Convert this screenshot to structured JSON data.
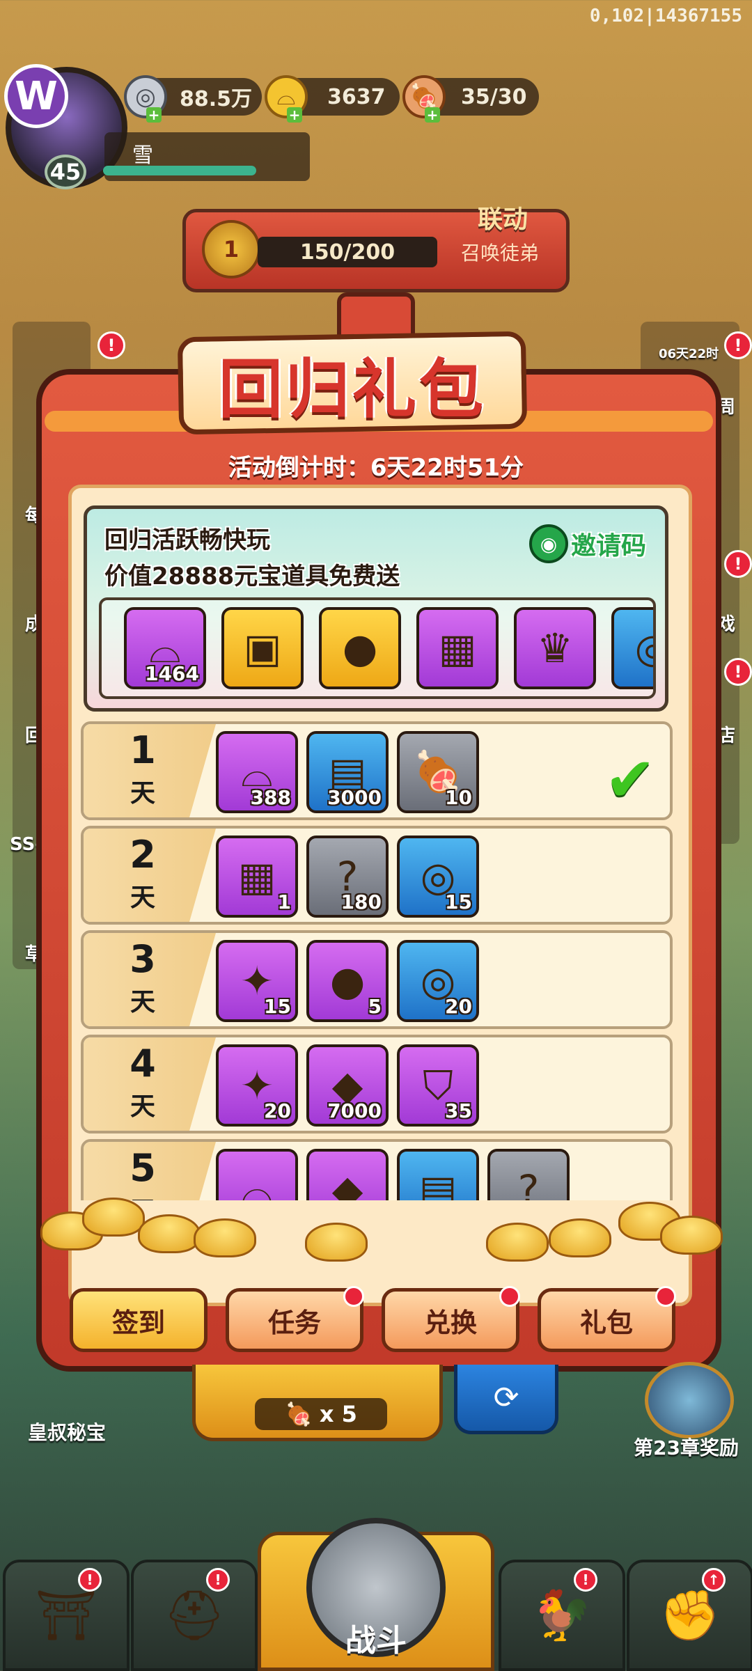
{
  "hud": {
    "server_id": "0,102|14367155",
    "avatar_logo": "W",
    "player_level": "45",
    "player_name": "雪",
    "resources": [
      {
        "icon": "silver-coin-icon",
        "glyph": "◎",
        "value": "88.5万"
      },
      {
        "icon": "gold-ingot-icon",
        "glyph": "⌓",
        "value": "3637"
      },
      {
        "icon": "meat-stamina-icon",
        "glyph": "🍖",
        "value": "35/30"
      }
    ]
  },
  "league": {
    "rank": "1",
    "progress": "150/200",
    "tag": "联动",
    "action": "召唤徒弟"
  },
  "modal": {
    "title": "回归礼包",
    "countdown": "活动倒计时：6天22时51分",
    "promo_title": "回归活跃畅快玩",
    "promo_subtitle": "价值28888元宝道具免费送",
    "invite_label": "邀请码",
    "promo_items": [
      {
        "name": "gold-ingot-item",
        "color": "purple",
        "glyph": "⌓",
        "qty": "1464"
      },
      {
        "name": "treasure-chest-item",
        "color": "gold",
        "glyph": "▣",
        "qty": ""
      },
      {
        "name": "golden-egg-item",
        "color": "gold",
        "glyph": "●",
        "qty": ""
      },
      {
        "name": "gift-box-item",
        "color": "purple",
        "glyph": "▦",
        "qty": ""
      },
      {
        "name": "lion-chest-item",
        "color": "purple",
        "glyph": "♛",
        "qty": ""
      },
      {
        "name": "silver-coin-item",
        "color": "blue",
        "glyph": "◎",
        "qty": ""
      }
    ],
    "days": [
      {
        "num": "1",
        "unit": "天",
        "claimed": true,
        "items": [
          {
            "name": "gold-ingot-item",
            "color": "purple",
            "glyph": "⌓",
            "qty": "388"
          },
          {
            "name": "scroll-item",
            "color": "blue",
            "glyph": "▤",
            "qty": "3000"
          },
          {
            "name": "meat-item",
            "color": "gray",
            "glyph": "🍖",
            "qty": "10"
          }
        ]
      },
      {
        "num": "2",
        "unit": "天",
        "claimed": false,
        "items": [
          {
            "name": "gift-box-item",
            "color": "purple",
            "glyph": "▦",
            "qty": "1"
          },
          {
            "name": "mystery-gem-item",
            "color": "gray",
            "glyph": "?",
            "qty": "180"
          },
          {
            "name": "silver-coin-item",
            "color": "blue",
            "glyph": "◎",
            "qty": "15"
          }
        ]
      },
      {
        "num": "3",
        "unit": "天",
        "claimed": false,
        "items": [
          {
            "name": "puzzle-piece-item",
            "color": "purple",
            "glyph": "✦",
            "qty": "15"
          },
          {
            "name": "egg-item",
            "color": "purple",
            "glyph": "●",
            "qty": "5"
          },
          {
            "name": "silver-coin-item",
            "color": "blue",
            "glyph": "◎",
            "qty": "20"
          }
        ]
      },
      {
        "num": "4",
        "unit": "天",
        "claimed": false,
        "items": [
          {
            "name": "puzzle-piece-item",
            "color": "purple",
            "glyph": "✦",
            "qty": "20"
          },
          {
            "name": "red-gem-item",
            "color": "purple",
            "glyph": "◆",
            "qty": "7000"
          },
          {
            "name": "armor-item",
            "color": "purple",
            "glyph": "⛉",
            "qty": "35"
          }
        ]
      },
      {
        "num": "5",
        "unit": "天",
        "claimed": false,
        "items": [
          {
            "name": "gold-ingot-item",
            "color": "purple",
            "glyph": "⌓",
            "qty": ""
          },
          {
            "name": "red-gem-item",
            "color": "purple",
            "glyph": "◆",
            "qty": ""
          },
          {
            "name": "scroll-item",
            "color": "blue",
            "glyph": "▤",
            "qty": ""
          },
          {
            "name": "mystery-gem-item",
            "color": "gray",
            "glyph": "?",
            "qty": ""
          }
        ]
      }
    ],
    "buttons": [
      {
        "name": "sign-in-button",
        "label": "签到",
        "style": "yellow",
        "dot": false
      },
      {
        "name": "tasks-button",
        "label": "任务",
        "style": "orange",
        "dot": true
      },
      {
        "name": "exchange-button",
        "label": "兑换",
        "style": "orange",
        "dot": true
      },
      {
        "name": "gift-pack-button",
        "label": "礼包",
        "style": "orange",
        "dot": true
      }
    ]
  },
  "side": {
    "right_timer": "06天22时",
    "left_labels": [
      "每",
      "成长",
      "回归",
      "SS-大",
      "草船"
    ],
    "right_labels": [
      "周",
      "戏",
      "店"
    ]
  },
  "lower": {
    "stamina": "x 5",
    "uncle_treasure": "皇叔秘宝",
    "chapter_reward": "第23章奖励",
    "battle_label": "战斗"
  },
  "colors": {
    "modal_red": "#d84a36",
    "panel_cream": "#fde9c6",
    "claimed_green": "#3ec520",
    "badge_red": "#e8243a"
  }
}
